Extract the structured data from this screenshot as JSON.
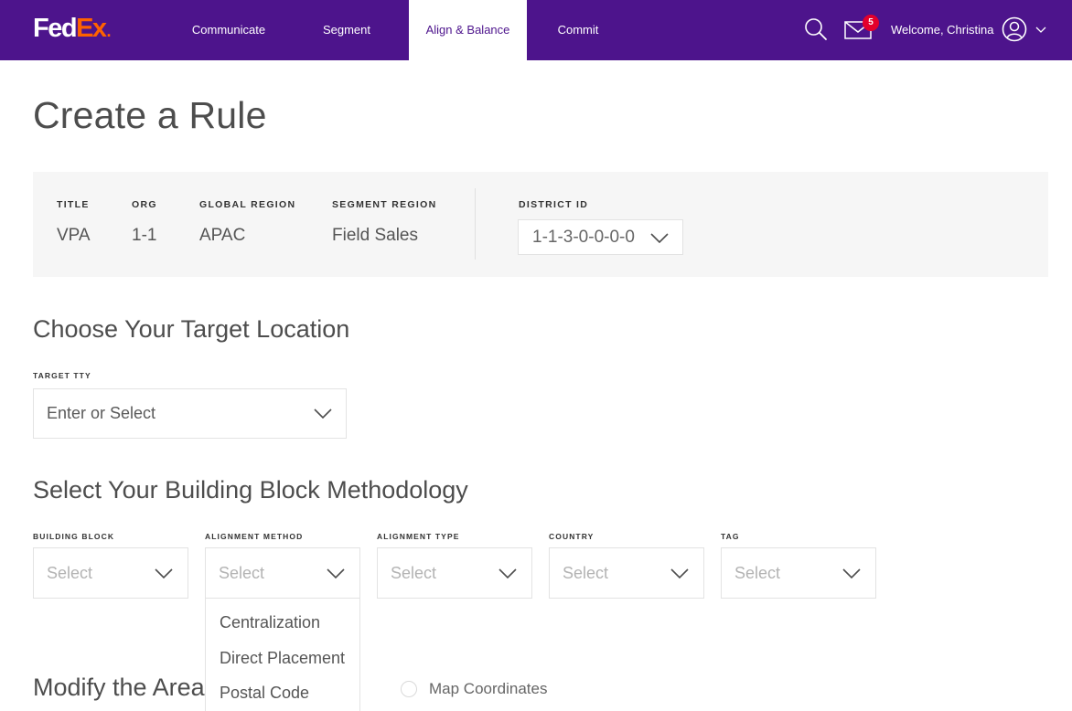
{
  "header": {
    "brand": {
      "part1": "Fed",
      "part2": "Ex",
      "dot": "."
    },
    "nav": [
      {
        "label": "Communicate",
        "active": false
      },
      {
        "label": "Segment",
        "active": false
      },
      {
        "label": "Align & Balance",
        "active": true
      },
      {
        "label": "Commit",
        "active": false
      }
    ],
    "icons": {
      "search": "search-icon",
      "mail": "mail-icon",
      "user": "user-icon",
      "caret": "chevron-down-icon"
    },
    "mail_badge_count": "5",
    "welcome_text": "Welcome, Christina"
  },
  "page": {
    "title": "Create a Rule"
  },
  "info_panel": {
    "fields": [
      {
        "label": "TITLE",
        "value": "VPA"
      },
      {
        "label": "ORG",
        "value": "1-1"
      },
      {
        "label": "GLOBAL REGION",
        "value": "APAC"
      },
      {
        "label": "SEGMENT REGION",
        "value": "Field Sales"
      }
    ],
    "district": {
      "label": "DISTRICT ID",
      "value": "1-1-3-0-0-0-0"
    }
  },
  "target_location": {
    "heading": "Choose Your Target Location",
    "field": {
      "label": "TARGET TTY",
      "placeholder": "Enter or Select"
    }
  },
  "building_block": {
    "heading": "Select Your Building Block Methodology",
    "fields": [
      {
        "label": "BUILDING BLOCK",
        "placeholder": "Select"
      },
      {
        "label": "ALIGNMENT METHOD",
        "placeholder": "Select"
      },
      {
        "label": "ALIGNMENT TYPE",
        "placeholder": "Select"
      },
      {
        "label": "COUNTRY",
        "placeholder": "Select"
      },
      {
        "label": "TAG",
        "placeholder": "Select"
      }
    ],
    "open_dropdown_options": [
      "Centralization",
      "Direct Placement",
      "Postal Code"
    ]
  },
  "modify_area": {
    "heading": "Modify the Area",
    "radio_option": "Map Coordinates"
  },
  "colors": {
    "brand_purple": "#4d148c",
    "brand_orange": "#ff6200",
    "badge_red": "#e4002b",
    "panel_gray": "#f6f6f6"
  }
}
